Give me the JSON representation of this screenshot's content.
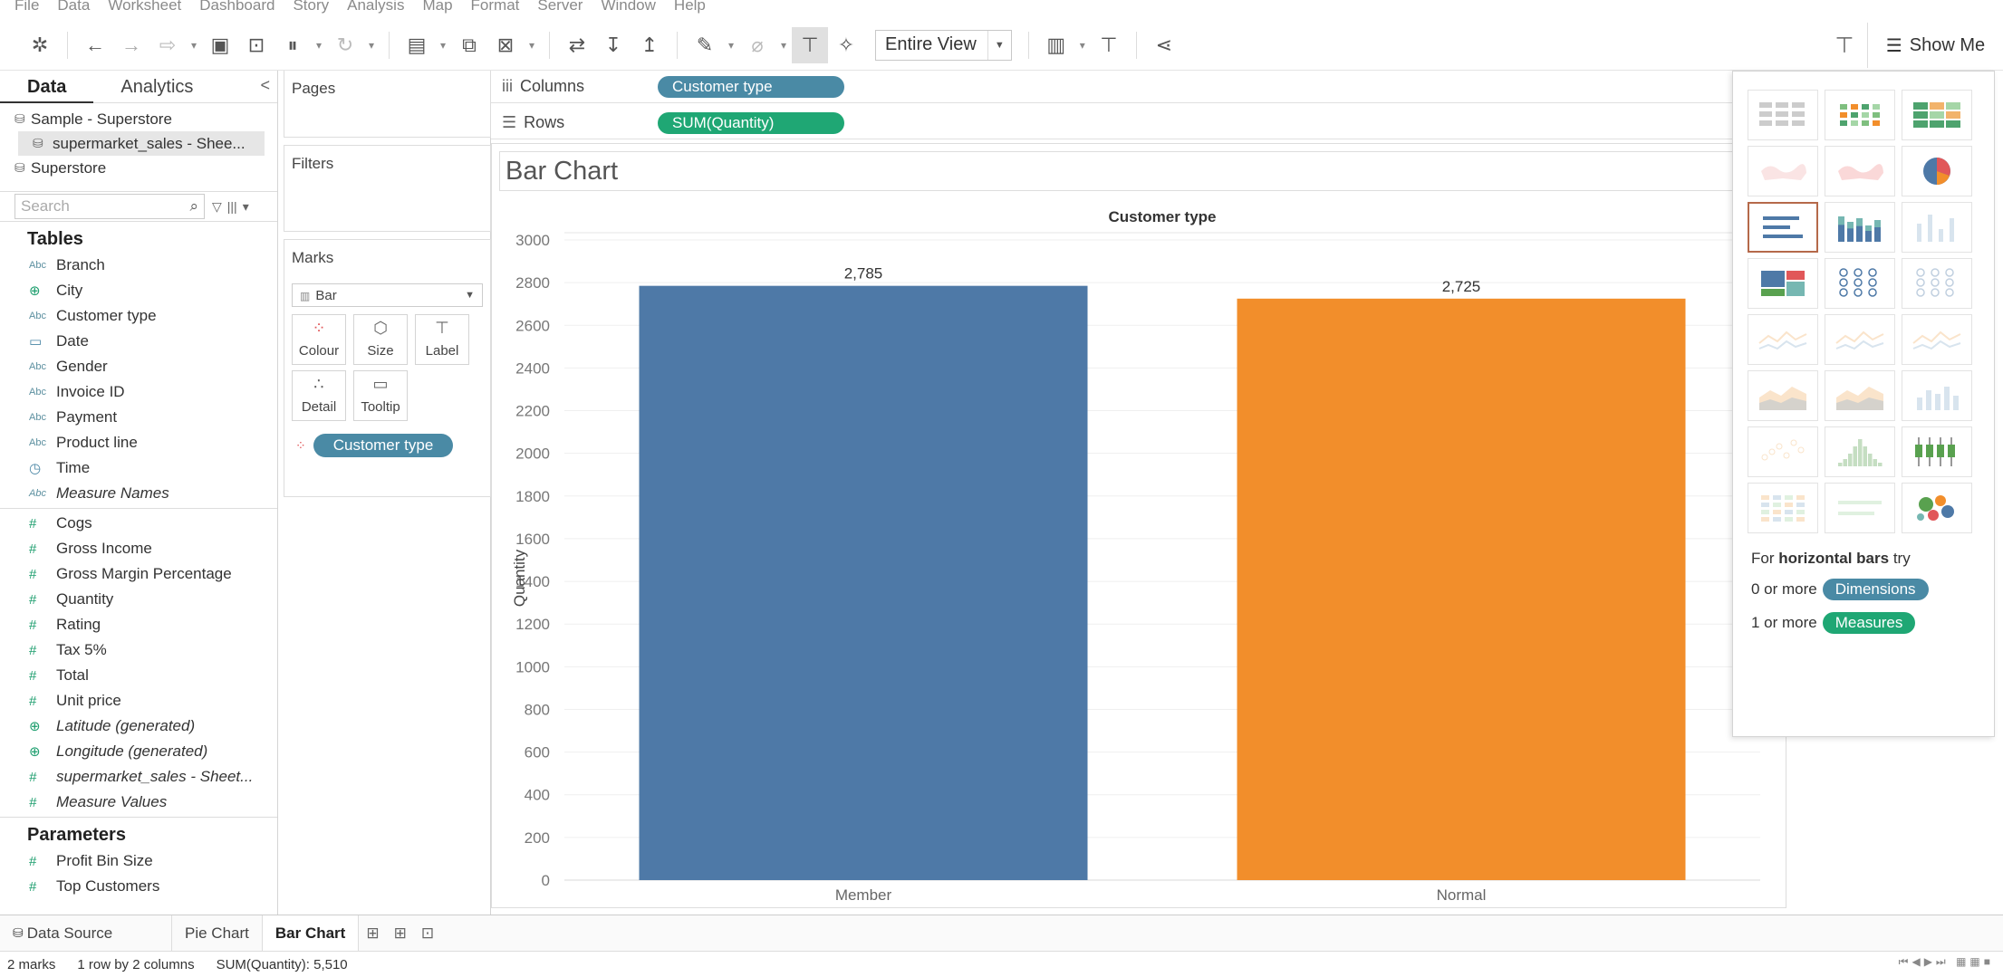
{
  "menu": [
    "File",
    "Data",
    "Worksheet",
    "Dashboard",
    "Story",
    "Analysis",
    "Map",
    "Format",
    "Server",
    "Window",
    "Help"
  ],
  "toolbar": {
    "entire_view": "Entire View",
    "show_me": "Show Me",
    "icons": [
      "tableau-logo-icon",
      "back-icon",
      "forward-icon",
      "redo-icon",
      "save-icon",
      "new-datasource-icon",
      "pause-icon",
      "refresh-icon",
      "new-worksheet-icon",
      "duplicate-icon",
      "clear-icon",
      "swap-icon",
      "sort-asc-icon",
      "sort-desc-icon",
      "highlight-icon",
      "group-icon",
      "label-icon",
      "pin-icon",
      "presentation-icon",
      "share-icon"
    ]
  },
  "data_pane": {
    "tab_data": "Data",
    "tab_analytics": "Analytics",
    "collapse": "<",
    "datasources": [
      "Sample - Superstore",
      "supermarket_sales - Shee...",
      "Superstore"
    ],
    "search_placeholder": "Search",
    "tables_title": "Tables",
    "dimensions": [
      {
        "type": "Abc",
        "name": "Branch"
      },
      {
        "type": "⊕",
        "name": "City"
      },
      {
        "type": "Abc",
        "name": "Customer type"
      },
      {
        "type": "▭",
        "name": "Date"
      },
      {
        "type": "Abc",
        "name": "Gender"
      },
      {
        "type": "Abc",
        "name": "Invoice ID"
      },
      {
        "type": "Abc",
        "name": "Payment"
      },
      {
        "type": "Abc",
        "name": "Product line"
      },
      {
        "type": "◷",
        "name": "Time"
      },
      {
        "type": "Abc",
        "name": "Measure Names"
      }
    ],
    "measures": [
      {
        "type": "#",
        "name": "Cogs"
      },
      {
        "type": "#",
        "name": "Gross Income"
      },
      {
        "type": "#",
        "name": "Gross Margin Percentage"
      },
      {
        "type": "#",
        "name": "Quantity"
      },
      {
        "type": "#",
        "name": "Rating"
      },
      {
        "type": "#",
        "name": "Tax 5%"
      },
      {
        "type": "#",
        "name": "Total"
      },
      {
        "type": "#",
        "name": "Unit price"
      },
      {
        "type": "⊕",
        "name": "Latitude (generated)"
      },
      {
        "type": "⊕",
        "name": "Longitude (generated)"
      },
      {
        "type": "#",
        "name": "supermarket_sales - Sheet..."
      },
      {
        "type": "#",
        "name": "Measure Values"
      }
    ],
    "parameters_title": "Parameters",
    "parameters": [
      {
        "type": "#",
        "name": "Profit Bin Size"
      },
      {
        "type": "#",
        "name": "Top Customers"
      }
    ]
  },
  "cards": {
    "pages": "Pages",
    "filters": "Filters",
    "marks": "Marks",
    "mark_type": "Bar",
    "buttons": [
      "Colour",
      "Size",
      "Label",
      "Detail",
      "Tooltip"
    ],
    "marks_pill": "Customer type"
  },
  "shelves": {
    "columns_label": "Columns",
    "columns_pill": "Customer type",
    "rows_label": "Rows",
    "rows_pill": "SUM(Quantity)"
  },
  "view": {
    "title": "Bar Chart"
  },
  "chart_data": {
    "type": "bar",
    "title": "Customer type",
    "categories": [
      "Member",
      "Normal"
    ],
    "values": [
      2785,
      2725
    ],
    "value_labels": [
      "2,785",
      "2,725"
    ],
    "colors": [
      "#4e79a7",
      "#f28e2b"
    ],
    "xlabel": "",
    "ylabel": "Quantity",
    "ylim": [
      0,
      3000
    ],
    "yticks": [
      0,
      200,
      400,
      600,
      800,
      1000,
      1200,
      1400,
      1600,
      1800,
      2000,
      2200,
      2400,
      2600,
      2800,
      3000
    ],
    "grid": true
  },
  "show_me": {
    "hint_prefix": "For",
    "hint_bold": "horizontal bars",
    "hint_suffix": "try",
    "row1_prefix": "0 or more",
    "row1_pill": "Dimensions",
    "row2_prefix": "1 or more",
    "row2_pill": "Measures"
  },
  "sheet_tabs": {
    "data_source": "Data Source",
    "tabs": [
      "Pie Chart",
      "Bar Chart"
    ],
    "active": "Bar Chart"
  },
  "status": {
    "marks": "2 marks",
    "dims": "1 row by 2 columns",
    "sum": "SUM(Quantity): 5,510"
  },
  "colors": {
    "dimension_pill": "#4a8aa5",
    "measure_pill": "#1fa774",
    "member_bar": "#4e79a7",
    "normal_bar": "#f28e2b"
  }
}
